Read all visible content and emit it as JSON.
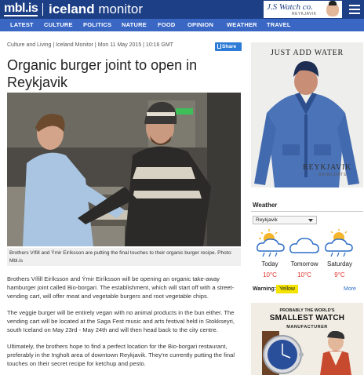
{
  "header": {
    "logo": "mbl.is",
    "site_name_bold": "iceland",
    "site_name_rest": " monitor",
    "ad_brand": "J.S Watch co.",
    "ad_brand_sub": "REYKJAVIK"
  },
  "nav": [
    "LATEST",
    "CULTURE",
    "POLITICS",
    "NATURE",
    "FOOD",
    "OPINION",
    "WEATHER",
    "TRAVEL"
  ],
  "article": {
    "meta": "Culture and Living | Iceland Monitor | Mon 11 May 2015 | 10:16 GMT",
    "share": "Share",
    "title": "Organic burger joint to open in Reykjavik",
    "caption": "Brothers Vífill and Ýmir Eiríksson are putting the final touches to their organic burger recipe. Photo: Mbl.is",
    "paragraphs": [
      "Brothers Vífill Eiríksson and Ýmir Eiríksson will be opening an organic take-away hamburger joint called Bio-borgari. The establishment, which will start off with a street-vending cart, will offer meat and vegetable burgers and root vegetable chips.",
      "The veggie burger will be entirely vegan with no animal products in the bun either. The vending cart will be located at the Saga Fest music and arts festival held in Stokkseyri, south Iceland on May 23rd - May 24th and will then head back to the city centre.",
      "Ultimately, the brothers hope to find a perfect location for the Bio-borgari restaurant, preferably in the Ingholt area of downtown Reykjavik.  They're currently putting the final touches on their secret recipe for ketchup and pesto."
    ]
  },
  "ad_top": {
    "headline": "JUST ADD WATER",
    "brand": "REYKJAVIK",
    "brand_sub": "RAINCOATS"
  },
  "weather": {
    "heading": "Weather",
    "location": "Reykjavik",
    "days": [
      {
        "day": "Today",
        "temp": "10°C",
        "icon": "sun-cloud-rain-icon"
      },
      {
        "day": "Tomorrow",
        "temp": "10°C",
        "icon": "cloud-icon"
      },
      {
        "day": "Saturday",
        "temp": "9°C",
        "icon": "sun-cloud-rain-icon"
      }
    ],
    "warning_label": "Warning:",
    "warning_level": "Yellow",
    "more": "More"
  },
  "ad_bottom": {
    "line1": "PROBABLY THE WORLD'S",
    "line2": "SMALLEST WATCH",
    "line3": "MANUFACTURER"
  },
  "colors": {
    "header_bg": "#1d3f86",
    "nav_bg": "#3a67c4",
    "share_bg": "#2d7bd6",
    "temp": "#e0332a",
    "warning": "#f5e300"
  }
}
